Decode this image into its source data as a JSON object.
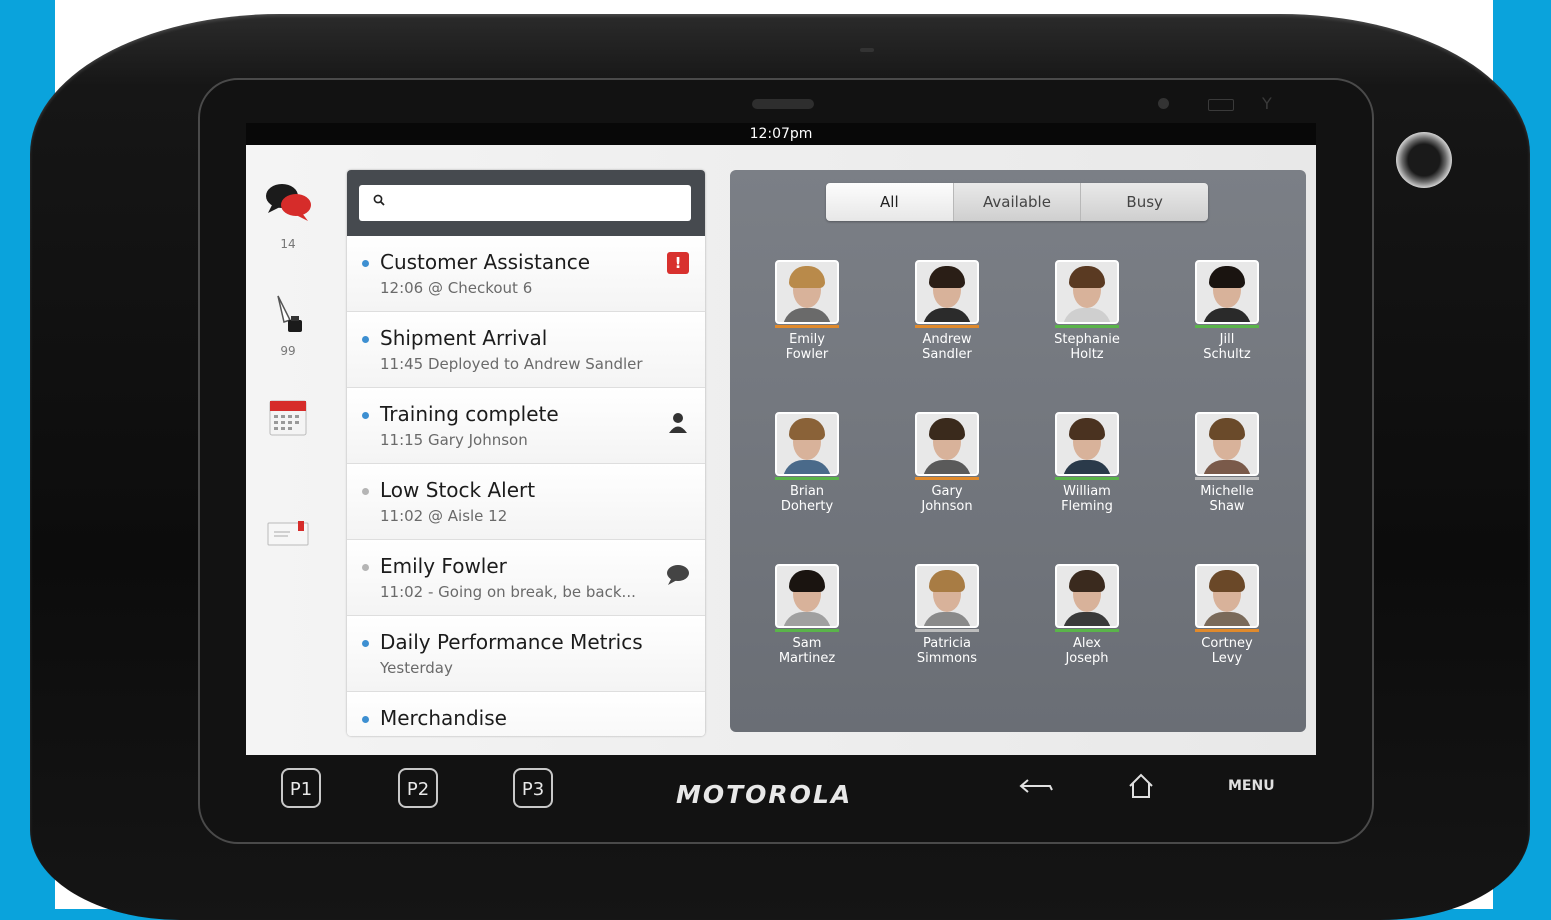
{
  "status_bar": {
    "time": "12:07pm"
  },
  "app_sidebar": {
    "items": [
      {
        "icon": "chat-bubbles-icon",
        "count": "14"
      },
      {
        "icon": "pen-ink-icon",
        "count": "99"
      },
      {
        "icon": "calendar-icon",
        "count": ""
      },
      {
        "icon": "envelope-icon",
        "count": ""
      }
    ]
  },
  "search": {
    "placeholder": ""
  },
  "messages": [
    {
      "title": "Customer Assistance",
      "sub": "12:06  @ Checkout 6",
      "unread": true,
      "badge": "!"
    },
    {
      "title": "Shipment Arrival",
      "sub": "11:45 Deployed to Andrew Sandler",
      "unread": true
    },
    {
      "title": "Training complete",
      "sub": "11:15 Gary Johnson",
      "unread": true,
      "icon": "person-icon"
    },
    {
      "title": "Low Stock Alert",
      "sub": "11:02  @ Aisle 12",
      "unread": false
    },
    {
      "title": "Emily  Fowler",
      "sub": "11:02 - Going on break, be back...",
      "unread": false,
      "icon": "chat-icon"
    },
    {
      "title": "Daily Performance Metrics",
      "sub": "Yesterday",
      "unread": true
    },
    {
      "title": "Merchandise",
      "sub": "",
      "unread": true
    }
  ],
  "filter_tabs": [
    "All",
    "Available",
    "Busy"
  ],
  "status_colors": {
    "busy": "#e08a2c",
    "available": "#5ab44a",
    "offline": "#bdbdbd"
  },
  "people": [
    {
      "first": "Emily",
      "last": "Fowler",
      "status": "busy"
    },
    {
      "first": "Andrew",
      "last": "Sandler",
      "status": "busy"
    },
    {
      "first": "Stephanie",
      "last": "Holtz",
      "status": "available"
    },
    {
      "first": "Jill",
      "last": "Schultz",
      "status": "available"
    },
    {
      "first": "Brian",
      "last": "Doherty",
      "status": "available"
    },
    {
      "first": "Gary",
      "last": "Johnson",
      "status": "busy"
    },
    {
      "first": "William",
      "last": "Fleming",
      "status": "available"
    },
    {
      "first": "Michelle",
      "last": "Shaw",
      "status": "offline"
    },
    {
      "first": "Sam",
      "last": "Martinez",
      "status": "available"
    },
    {
      "first": "Patricia",
      "last": "Simmons",
      "status": "offline"
    },
    {
      "first": "Alex",
      "last": "Joseph",
      "status": "available"
    },
    {
      "first": "Cortney",
      "last": "Levy",
      "status": "busy"
    }
  ],
  "hardware_keys": {
    "p1": "P1",
    "p2": "P2",
    "p3": "P3",
    "brand": "MOTOROLA",
    "menu": "MENU"
  }
}
